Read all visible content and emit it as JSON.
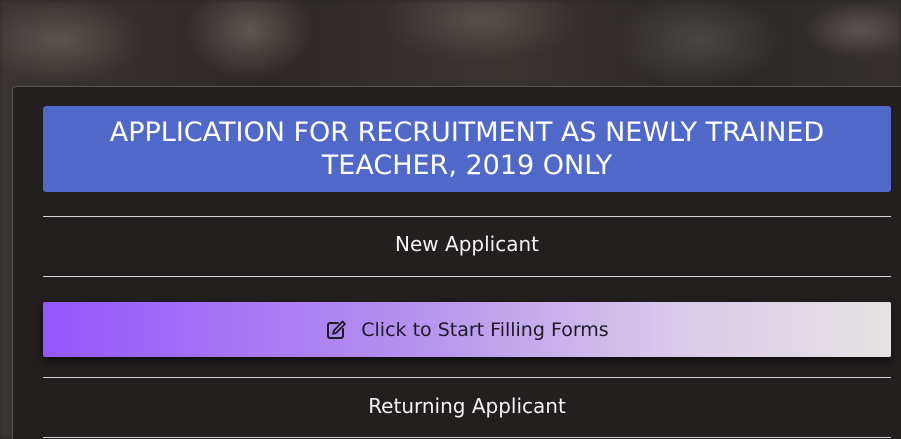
{
  "form": {
    "title": "APPLICATION FOR RECRUITMENT AS NEWLY TRAINED TEACHER, 2019 ONLY",
    "new_applicant_label": "New Applicant",
    "start_button_label": "Click to Start Filling Forms",
    "start_button_icon": "edit-icon",
    "returning_applicant_label": "Returning Applicant"
  },
  "colors": {
    "title_background": "#5069c8",
    "button_gradient_start": "#9457fb",
    "button_gradient_end": "#e6e2e2",
    "panel_background": "#231f1f"
  }
}
